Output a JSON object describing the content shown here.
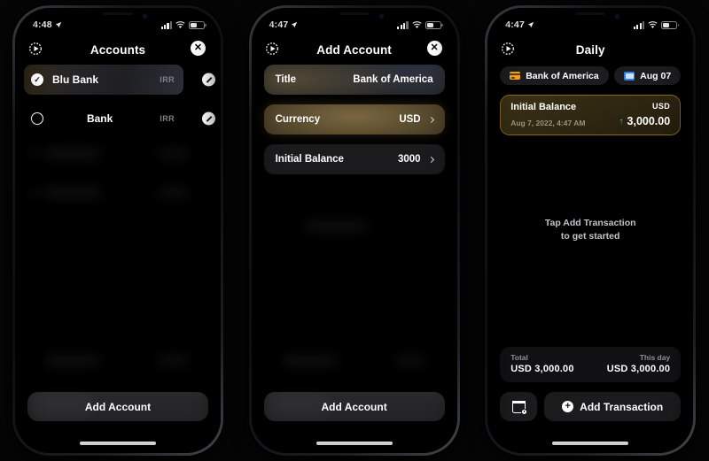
{
  "colors": {
    "accent_gold": "#8a6a1e",
    "card_orange": "#f0a020",
    "calendar_blue": "#2f7ff0",
    "positive_green": "#45d07a",
    "panel": "#1b1b1d",
    "background": "#000000"
  },
  "phones": [
    {
      "id": "accounts",
      "status_bar": {
        "time": "4:48",
        "location_icon": "location-arrow-icon",
        "signal_icon": "cellular-bars-icon",
        "wifi_icon": "wifi-icon",
        "battery_icon": "battery-icon"
      },
      "nav": {
        "left_icon": "settings-gear-icon",
        "title": "Accounts",
        "close_label": "✕"
      },
      "accounts": [
        {
          "name": "Blu Bank",
          "currency": "IRR",
          "selected": true,
          "check": "✓",
          "edit_icon": "edit-pencil-icon"
        },
        {
          "name": "Bank",
          "currency": "IRR",
          "selected": false,
          "check": "",
          "edit_icon": "edit-pencil-icon"
        }
      ],
      "cta_label": "Add Account"
    },
    {
      "id": "add-account",
      "status_bar": {
        "time": "4:47",
        "location_icon": "location-arrow-icon",
        "signal_icon": "cellular-bars-icon",
        "wifi_icon": "wifi-icon",
        "battery_icon": "battery-icon"
      },
      "nav": {
        "left_icon": "settings-gear-icon",
        "title": "Add Account",
        "close_label": "✕"
      },
      "fields": [
        {
          "label": "Title",
          "value": "Bank of America",
          "chevron": false,
          "style": "glow-title"
        },
        {
          "label": "Currency",
          "value": "USD",
          "chevron": true,
          "style": "glow-currency"
        },
        {
          "label": "Initial Balance",
          "value": "3000",
          "chevron": true,
          "style": "plain"
        }
      ],
      "cta_label": "Add Account"
    },
    {
      "id": "daily",
      "status_bar": {
        "time": "4:47",
        "location_icon": "location-arrow-icon",
        "signal_icon": "cellular-bars-icon",
        "wifi_icon": "wifi-icon",
        "battery_icon": "battery-icon"
      },
      "nav": {
        "left_icon": "settings-gear-icon",
        "title": "Daily"
      },
      "chips": {
        "account": {
          "label": "Bank of America",
          "icon": "credit-card-icon"
        },
        "date": {
          "label": "Aug 07",
          "icon": "calendar-icon"
        }
      },
      "transaction": {
        "title": "Initial Balance",
        "date": "Aug 7, 2022, 4:47 AM",
        "currency": "USD",
        "direction_icon": "↑",
        "amount": "3,000.00"
      },
      "empty_hint_line1": "Tap Add Transaction",
      "empty_hint_line2": "to get started",
      "summary": {
        "total_label": "Total",
        "total_value": "USD 3,000.00",
        "thisday_label": "This day",
        "thisday_value": "USD 3,000.00"
      },
      "actions": {
        "calendar_button_icon": "calendar-clock-icon",
        "add_transaction_label": "Add Transaction",
        "add_icon": "plus-circle-icon"
      }
    }
  ]
}
